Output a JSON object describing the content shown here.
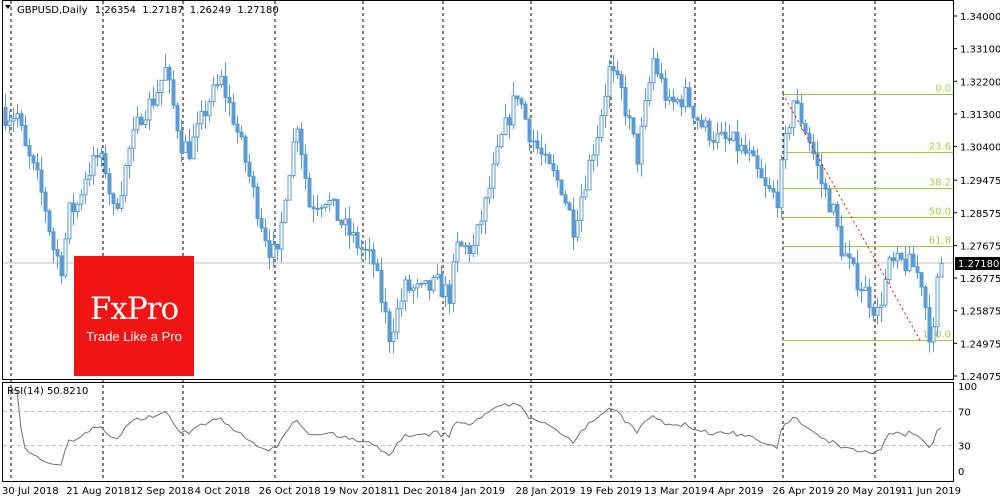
{
  "header": {
    "symbol_timeframe": "GBPUSD,Daily",
    "open": "1.26354",
    "high": "1.27187",
    "low": "1.26249",
    "close": "1.27180"
  },
  "price_axis": {
    "ticks": [
      "1.34000",
      "1.33100",
      "1.32200",
      "1.31300",
      "1.30400",
      "1.29475",
      "1.28575",
      "1.27675",
      "1.26775",
      "1.25875",
      "1.24975",
      "1.24075"
    ],
    "current_price": "1.27180"
  },
  "rsi": {
    "label": "RSI(14) 50.8210",
    "levels": [
      "100",
      "70",
      "30",
      "0"
    ]
  },
  "time_axis": [
    "30 Jul 2018",
    "21 Aug 2018",
    "12 Sep 2018",
    "4 Oct 2018",
    "26 Oct 2018",
    "19 Nov 2018",
    "11 Dec 2018",
    "4 Jan 2019",
    "28 Jan 2019",
    "19 Feb 2019",
    "13 Mar 2019",
    "4 Apr 2019",
    "26 Apr 2019",
    "20 May 2019",
    "11 Jun 2019"
  ],
  "logo": {
    "brand": "FxPro",
    "tagline": "Trade Like a Pro"
  },
  "colors": {
    "candle": "#5b9bd5",
    "fib": "#9acd32",
    "trend": "#ff0000",
    "logo_bg": "#f01414"
  },
  "chart_data": {
    "type": "candlestick",
    "title": "GBPUSD,Daily",
    "ylim": [
      1.24075,
      1.34
    ],
    "close_path": [
      [
        0,
        1.3128
      ],
      [
        3,
        1.3128
      ],
      [
        5,
        1.303
      ],
      [
        8,
        1.295
      ],
      [
        10,
        1.287
      ],
      [
        12,
        1.276
      ],
      [
        14,
        1.271
      ],
      [
        16,
        1.286
      ],
      [
        18,
        1.288
      ],
      [
        20,
        1.296
      ],
      [
        23,
        1.301
      ],
      [
        25,
        1.298
      ],
      [
        27,
        1.286
      ],
      [
        29,
        1.293
      ],
      [
        31,
        1.303
      ],
      [
        34,
        1.313
      ],
      [
        37,
        1.317
      ],
      [
        40,
        1.325
      ],
      [
        42,
        1.315
      ],
      [
        44,
        1.305
      ],
      [
        46,
        1.303
      ],
      [
        48,
        1.308
      ],
      [
        51,
        1.317
      ],
      [
        54,
        1.322
      ],
      [
        57,
        1.312
      ],
      [
        60,
        1.3
      ],
      [
        63,
        1.287
      ],
      [
        66,
        1.276
      ],
      [
        68,
        1.273
      ],
      [
        70,
        1.292
      ],
      [
        73,
        1.311
      ],
      [
        76,
        1.288
      ],
      [
        80,
        1.29
      ],
      [
        84,
        1.283
      ],
      [
        88,
        1.277
      ],
      [
        92,
        1.272
      ],
      [
        96,
        1.252
      ],
      [
        100,
        1.265
      ],
      [
        104,
        1.264
      ],
      [
        108,
        1.266
      ],
      [
        111,
        1.263
      ],
      [
        113,
        1.276
      ],
      [
        117,
        1.276
      ],
      [
        120,
        1.288
      ],
      [
        124,
        1.306
      ],
      [
        128,
        1.319
      ],
      [
        131,
        1.308
      ],
      [
        135,
        1.299
      ],
      [
        139,
        1.293
      ],
      [
        142,
        1.282
      ],
      [
        145,
        1.295
      ],
      [
        148,
        1.308
      ],
      [
        151,
        1.325
      ],
      [
        154,
        1.319
      ],
      [
        158,
        1.301
      ],
      [
        162,
        1.328
      ],
      [
        166,
        1.315
      ],
      [
        170,
        1.318
      ],
      [
        174,
        1.31
      ],
      [
        178,
        1.306
      ],
      [
        182,
        1.305
      ],
      [
        186,
        1.301
      ],
      [
        190,
        1.292
      ],
      [
        193,
        1.29
      ],
      [
        195,
        1.305
      ],
      [
        197,
        1.317
      ],
      [
        201,
        1.306
      ],
      [
        204,
        1.294
      ],
      [
        207,
        1.286
      ],
      [
        209,
        1.276
      ],
      [
        212,
        1.269
      ],
      [
        215,
        1.264
      ],
      [
        218,
        1.258
      ],
      [
        221,
        1.271
      ],
      [
        224,
        1.272
      ],
      [
        227,
        1.271
      ],
      [
        229,
        1.267
      ],
      [
        231,
        1.253
      ],
      [
        232,
        1.252
      ],
      [
        233,
        1.266
      ],
      [
        234,
        1.2718
      ]
    ],
    "fibonacci": {
      "high": 1.3185,
      "low": 1.2506,
      "levels": [
        "0.0",
        "23.6",
        "38.2",
        "50.0",
        "61.8",
        "100.0"
      ],
      "ratios": [
        0,
        0.236,
        0.382,
        0.5,
        0.618,
        1.0
      ]
    },
    "rsi_period": 14,
    "rsi_levels": [
      70,
      30
    ]
  }
}
